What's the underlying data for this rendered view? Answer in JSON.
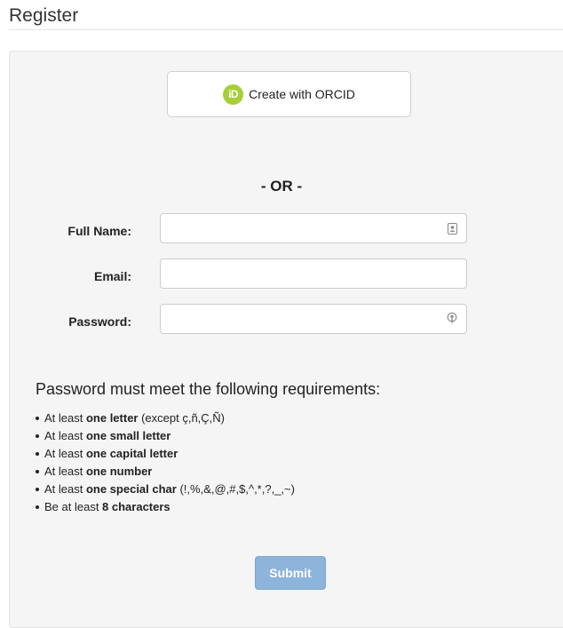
{
  "page": {
    "title": "Register"
  },
  "orcid": {
    "icon_text": "iD",
    "label": "Create with ORCID"
  },
  "divider": {
    "text": "- OR -"
  },
  "form": {
    "full_name_label": "Full Name:",
    "email_label": "Email:",
    "password_label": "Password:",
    "full_name_value": "",
    "email_value": "",
    "password_value": ""
  },
  "requirements": {
    "heading": "Password must meet the following requirements:",
    "items": [
      {
        "prefix": "At least ",
        "bold": "one letter",
        "suffix": " (except ç,ñ,Ç,Ñ)"
      },
      {
        "prefix": "At least ",
        "bold": "one small letter",
        "suffix": ""
      },
      {
        "prefix": "At least ",
        "bold": "one capital letter",
        "suffix": ""
      },
      {
        "prefix": "At least ",
        "bold": "one number",
        "suffix": ""
      },
      {
        "prefix": "At least ",
        "bold": "one special char",
        "suffix": " (!,%,&,@,#,$,^,*,?,_,~)"
      },
      {
        "prefix": "Be at least ",
        "bold": "8 characters",
        "suffix": ""
      }
    ]
  },
  "submit": {
    "label": "Submit"
  },
  "colors": {
    "orcid_green": "#a6ce39",
    "submit_blue": "#8db4da",
    "panel_bg": "#f5f5f5"
  },
  "icons": {
    "orcid": "orcid-icon",
    "contact_card": "contact-card-icon",
    "password_key": "password-key-icon"
  }
}
